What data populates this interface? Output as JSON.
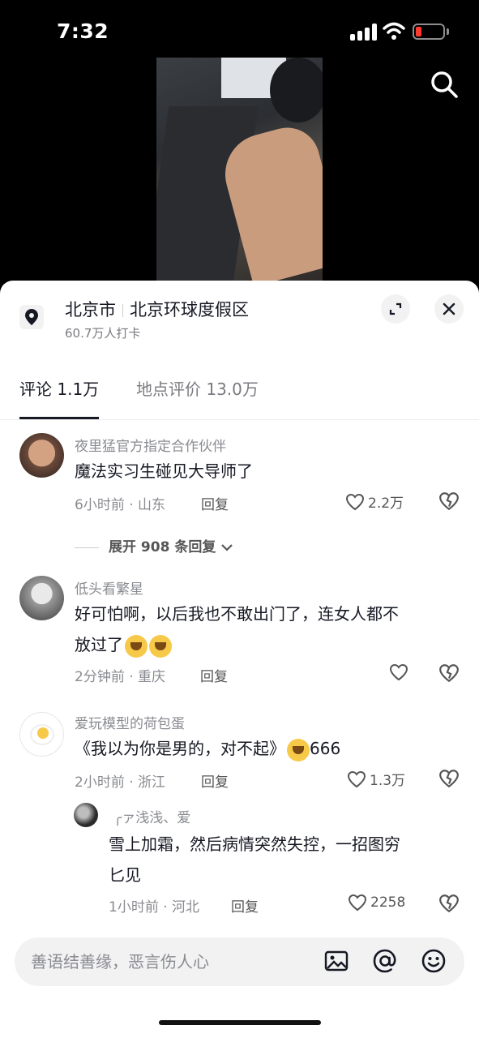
{
  "status": {
    "time": "7:32"
  },
  "location": {
    "city": "北京市",
    "place": "北京环球度假区",
    "checkins": "60.7万人打卡"
  },
  "tabs": [
    {
      "label": "评论 1.1万"
    },
    {
      "label": "地点评价 13.0万"
    }
  ],
  "comments": [
    {
      "name": "夜里猛官方指定合作伙伴",
      "text": "魔法实习生碰见大导师了",
      "time_loc": "6小时前 · 山东",
      "reply": "回复",
      "likes": "2.2万",
      "expand": "展开 908 条回复"
    },
    {
      "name": "低头看繁星",
      "text_line1": "好可怕啊，以后我也不敢出门了，连女人都不",
      "text_line2": "放过了",
      "time_loc": "2分钟前 · 重庆",
      "reply": "回复",
      "likes": ""
    },
    {
      "name": "爱玩模型的荷包蛋",
      "text_pre": "《我以为你是男的，对不起》",
      "text_post": "666",
      "time_loc": "2小时前 · 浙江",
      "reply": "回复",
      "likes": "1.3万"
    },
    {
      "name": "╭ァ浅浅、爱",
      "text_line1": "雪上加霜，然后病情突然失控，一招图穷",
      "text_line2": "匕见",
      "time_loc": "1小时前 · 河北",
      "reply": "回复",
      "likes": "2258"
    }
  ],
  "input": {
    "placeholder": "善语结善缘，恶言伤人心"
  },
  "icons": [
    "search-icon",
    "location-pin-icon",
    "expand-icon",
    "close-icon",
    "heart-icon",
    "broken-heart-icon",
    "chevron-down-icon",
    "image-icon",
    "at-icon",
    "emoji-icon"
  ]
}
